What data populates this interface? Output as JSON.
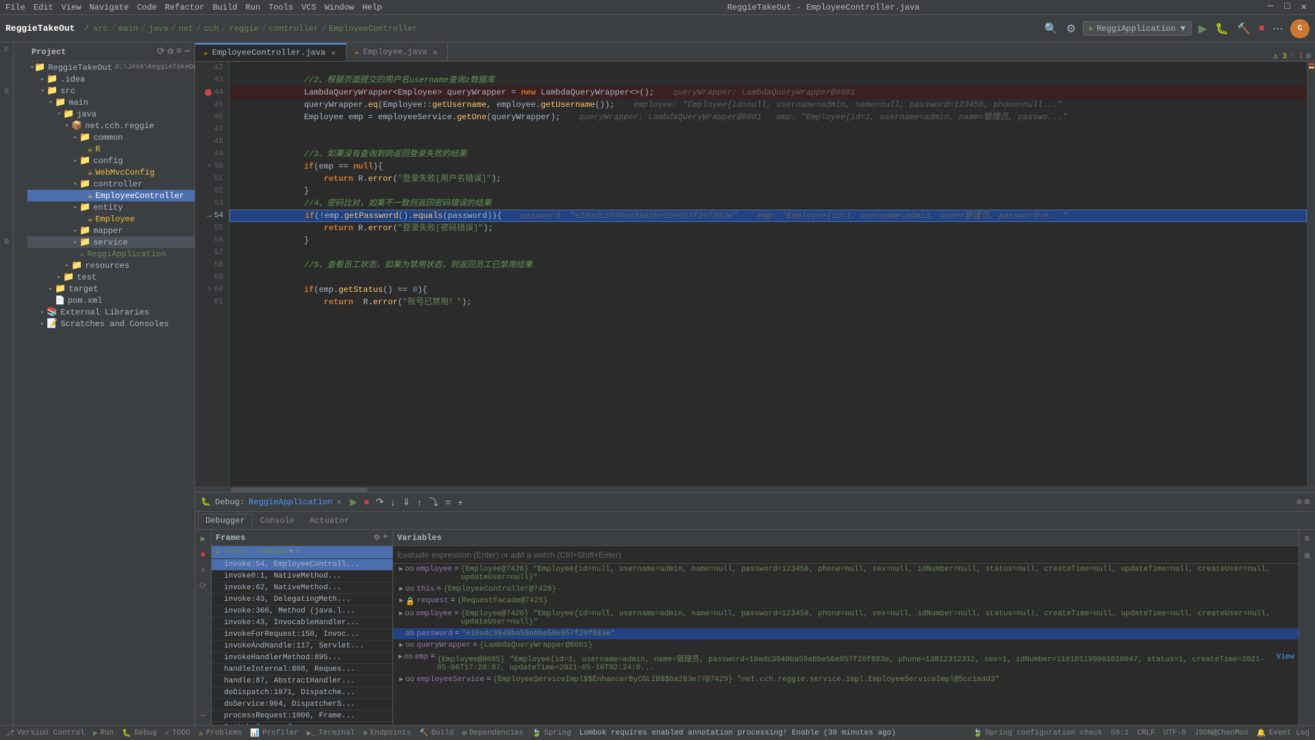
{
  "app": {
    "name": "ReggieTakeOut",
    "title": "ReggieTakeOut - EmployeeController.java"
  },
  "menu": {
    "items": [
      "File",
      "Edit",
      "View",
      "Navigate",
      "Code",
      "Refactor",
      "Build",
      "Run",
      "Tools",
      "VCS",
      "Window",
      "Help"
    ]
  },
  "breadcrumb": {
    "parts": [
      "src",
      "main",
      "java",
      "net",
      "cch",
      "reggie",
      "controller",
      "EmployeeController"
    ]
  },
  "run_config": {
    "label": "ReggiApplication ▼"
  },
  "tabs": {
    "editor": [
      {
        "label": "EmployeeController.java",
        "icon": "J",
        "active": true
      },
      {
        "label": "Employee.java",
        "icon": "J",
        "active": false
      }
    ]
  },
  "code": {
    "lines": [
      {
        "num": 42,
        "content": "",
        "type": "normal"
      },
      {
        "num": 43,
        "content": "//2、根据页面提交的用户名username查询z数据库",
        "type": "comment"
      },
      {
        "num": 44,
        "content": "LambdaQueryWrapper<Employee> queryWrapper = new LambdaQueryWrapper<>();   queryWrapper: LambdaQueryWrapper@8601",
        "type": "breakpoint"
      },
      {
        "num": 45,
        "content": "queryWrapper.eq(Employee::getUsername, employee.getUsername());   employee: \"Employee{id=null, username=admin, name=null, password=123456, phone=null, ...\"",
        "type": "normal"
      },
      {
        "num": 46,
        "content": "Employee emp = employeeService.getOne(queryWrapper);   queryWrapper: LambdaQueryWrapper@8601    emp: \"Employee{id=1, username=admin, name=管理员, passwo...\"",
        "type": "normal"
      },
      {
        "num": 47,
        "content": "",
        "type": "normal"
      },
      {
        "num": 48,
        "content": "",
        "type": "normal"
      },
      {
        "num": 49,
        "content": "//3、如果没有查询到则返回登录失败的结果",
        "type": "comment"
      },
      {
        "num": 50,
        "content": "if(emp == null){",
        "type": "normal"
      },
      {
        "num": 51,
        "content": "    return R.error(\"登录失败[用户名错误]\");",
        "type": "normal"
      },
      {
        "num": 52,
        "content": "}",
        "type": "normal"
      },
      {
        "num": 53,
        "content": "//4、密码比对，如果不一致则返回密码错误的结果",
        "type": "comment"
      },
      {
        "num": 54,
        "content": "if(!emp.getPassword().equals(password)){   password: \"e10adc3949ba59abbe56e057f20f883e\"    emp: \"Employee{id=1, username=admin, name=管理员, password=e..\"",
        "type": "highlighted"
      },
      {
        "num": 55,
        "content": "    return R.error(\"登录失败[密码错误]\");",
        "type": "normal"
      },
      {
        "num": 56,
        "content": "}",
        "type": "normal"
      },
      {
        "num": 57,
        "content": "",
        "type": "normal"
      },
      {
        "num": 58,
        "content": "//5、查看员工状态，如果为禁用状态，则返回员工已禁用结果",
        "type": "comment"
      },
      {
        "num": 59,
        "content": "",
        "type": "normal"
      },
      {
        "num": 60,
        "content": "if(emp.getStatus() == 0){",
        "type": "normal"
      },
      {
        "num": 61,
        "content": "    return R.error(\"账号已禁用！\");",
        "type": "normal"
      }
    ]
  },
  "sidebar": {
    "header": "Project",
    "items": [
      {
        "id": "reggieTakeOut",
        "label": "ReggieTakeOut",
        "depth": 0,
        "arrow": "open",
        "icon": "📁"
      },
      {
        "id": "src",
        "label": "src",
        "depth": 1,
        "arrow": "open",
        "icon": "📁"
      },
      {
        "id": "main",
        "label": "main",
        "depth": 2,
        "arrow": "open",
        "icon": "📁"
      },
      {
        "id": "java",
        "label": "java",
        "depth": 3,
        "arrow": "open",
        "icon": "📁"
      },
      {
        "id": "net.cch.reggie",
        "label": "net.cch.reggie",
        "depth": 4,
        "arrow": "open",
        "icon": "📦"
      },
      {
        "id": "common",
        "label": "common",
        "depth": 5,
        "arrow": "closed",
        "icon": "📁"
      },
      {
        "id": "R",
        "label": "R",
        "depth": 6,
        "arrow": "leaf",
        "icon": "☕"
      },
      {
        "id": "config",
        "label": "config",
        "depth": 5,
        "arrow": "closed",
        "icon": "📁"
      },
      {
        "id": "WebMvcConfig",
        "label": "WebMvcConfig",
        "depth": 6,
        "arrow": "leaf",
        "icon": "☕"
      },
      {
        "id": "controller",
        "label": "controller",
        "depth": 5,
        "arrow": "open",
        "icon": "📁"
      },
      {
        "id": "EmployeeController",
        "label": "EmployeeController",
        "depth": 6,
        "arrow": "leaf",
        "icon": "☕",
        "selected": true
      },
      {
        "id": "entity",
        "label": "entity",
        "depth": 5,
        "arrow": "closed",
        "icon": "📁"
      },
      {
        "id": "Employee",
        "label": "Employee",
        "depth": 6,
        "arrow": "leaf",
        "icon": "☕"
      },
      {
        "id": "mapper",
        "label": "mapper",
        "depth": 5,
        "arrow": "closed",
        "icon": "📁"
      },
      {
        "id": "service",
        "label": "service",
        "depth": 5,
        "arrow": "closed",
        "icon": "📁",
        "highlighted": true
      },
      {
        "id": "ReggiApplication",
        "label": "ReggiApplication",
        "depth": 5,
        "arrow": "leaf",
        "icon": "☕"
      },
      {
        "id": "resources",
        "label": "resources",
        "depth": 4,
        "arrow": "closed",
        "icon": "📁"
      },
      {
        "id": "test",
        "label": "test",
        "depth": 3,
        "arrow": "closed",
        "icon": "📁"
      },
      {
        "id": "target",
        "label": "target",
        "depth": 2,
        "arrow": "closed",
        "icon": "📁"
      },
      {
        "id": "pom.xml",
        "label": "pom.xml",
        "depth": 2,
        "arrow": "leaf",
        "icon": "📄"
      },
      {
        "id": "ExternalLibraries",
        "label": "External Libraries",
        "depth": 1,
        "arrow": "closed",
        "icon": "📚"
      },
      {
        "id": "ScratchesAndConsoles",
        "label": "Scratches and Consoles",
        "depth": 1,
        "arrow": "closed",
        "icon": "📝"
      }
    ]
  },
  "debug": {
    "panel_title": "ReggieApplication",
    "tabs": [
      "Debugger",
      "Console",
      "Actuator"
    ],
    "active_tab": "Debugger",
    "frames_label": "Frames",
    "variables_label": "Variables",
    "frames": [
      {
        "id": "f1",
        "icon": "▶",
        "label": "*http...UNNING ▼",
        "type": "thread",
        "selected": true
      },
      {
        "id": "f2",
        "name": "invoke:54, EmployeeControll...",
        "selected": true
      },
      {
        "id": "f3",
        "name": "invoke0:1, NativeMethod..."
      },
      {
        "id": "f4",
        "name": "invoke:62, NativeMethod..."
      },
      {
        "id": "f5",
        "name": "invoke:43, DelegatingMeth..."
      },
      {
        "id": "f6",
        "name": "invoke:366, Method (java.l..."
      },
      {
        "id": "f7",
        "name": "invoke:43, InvocableHandler..."
      },
      {
        "id": "f8",
        "name": "invokeForRequest:150, Invoc..."
      },
      {
        "id": "f9",
        "name": "invokeAndHandle:117, Servlet..."
      },
      {
        "id": "f10",
        "name": "invokeHandlerMethod:895..."
      },
      {
        "id": "f11",
        "name": "handleInternal:808, Reques..."
      },
      {
        "id": "f12",
        "name": "handle:87, AbstractHandler..."
      },
      {
        "id": "f13",
        "name": "doDispatch:1071, Dispatche..."
      },
      {
        "id": "f14",
        "name": "doService:964, DispatcherS..."
      },
      {
        "id": "f15",
        "name": "processRequest:1006, Frame..."
      },
      {
        "id": "f16",
        "name": "Switch frames from anyw..."
      }
    ],
    "variables": [
      {
        "indent": 0,
        "name": "employee",
        "eq": "=",
        "val": "{Employee@7426}",
        "desc": "\"Employee{id=null, username=admin, name=null, password=123456, phone=null, sex=null, idNumber=null, status=null, createTime=null, updateTime=null, createUser=null, updateUser=null}\"",
        "expand": true,
        "icon": "oo"
      },
      {
        "indent": 0,
        "name": "this",
        "eq": "=",
        "val": "{EmployeeController@7428}",
        "expand": true,
        "icon": "oo"
      },
      {
        "indent": 0,
        "name": "request",
        "eq": "=",
        "val": "{RequestFacade@7425}",
        "expand": true,
        "icon": "lock",
        "locked": true
      },
      {
        "indent": 0,
        "name": "employee",
        "eq": "=",
        "val": "{Employee@7426}",
        "desc": "\"Employee{id=null, username=admin, name=null, password=123456, phone=null, sex=null, idNumber=null, status=null, createTime=null, updateTime=null, createUser=null, updateUser=null}\"",
        "expand": true,
        "icon": "oo"
      },
      {
        "indent": 0,
        "name": "password",
        "eq": "=",
        "val": "\"e10adc3949ba59abbe56e057f20f883e\"",
        "expand": false,
        "icon": "str",
        "selected": true
      },
      {
        "indent": 0,
        "name": "queryWrapper",
        "eq": "=",
        "val": "{LambdaQueryWrapper@8601}",
        "expand": true,
        "icon": "oo"
      },
      {
        "indent": 0,
        "name": "emp",
        "eq": "=",
        "val": "{Employee@9085}",
        "desc": "\"Employee{id=1, username=admin, name=管理员, password=10adc3949ba59abbe56e057f20f883e, phone=13812312312, sex=1, idNumber=110101199001010047, status=1, createTime=2021-05-06T17:20:07, updateTime=2021-05-10T02:24:0... View\"",
        "expand": true,
        "icon": "oo"
      },
      {
        "indent": 0,
        "name": "employeeService",
        "eq": "=",
        "val": "{EmployeeServiceImpl$$EnhancerByCGLIB$$ba283e77@7429}",
        "desc": "\"net.cch.reggie.service.impl.EmployeeServiceImpl@5cc1add3\"",
        "expand": true,
        "icon": "oo"
      }
    ],
    "expression_placeholder": "Evaluate expression (Enter) or add a watch (Ctrl+Shift+Enter)"
  },
  "status_bar": {
    "version_control": "Version Control",
    "run_label": "Run",
    "debug_label": "Debug",
    "todo_label": "TODO",
    "problems_label": "Problems",
    "profiler_label": "Profiler",
    "terminal_label": "Terminal",
    "endpoints_label": "Endpoints",
    "build_label": "Build",
    "dependencies_label": "Dependencies",
    "spring_label": "Spring",
    "spring_config": "Spring configuration check",
    "position": "50:1",
    "line_ending": "CRLF",
    "encoding": "UTF-8",
    "git_user": "JSON@ChenMon",
    "event_log": "Event Log",
    "notification": "Lombok requires enabled annotation processing! Enable (39 minutes ago)"
  }
}
